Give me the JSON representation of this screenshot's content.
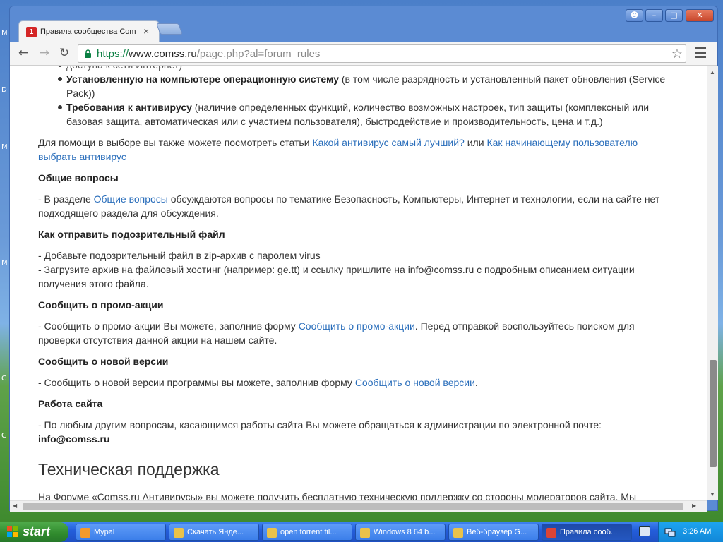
{
  "desktop": {
    "letters": [
      "M",
      "D",
      "M",
      "M",
      "C",
      "G"
    ]
  },
  "window": {
    "tab": {
      "favicon_text": "1",
      "title": "Правила сообщества Comss",
      "close_glyph": "×"
    },
    "controls": {
      "user_glyph": "☻",
      "minimize_glyph": "–",
      "maximize_glyph": "□",
      "close_glyph": "✕"
    }
  },
  "toolbar": {
    "back_glyph": "←",
    "forward_glyph": "→",
    "reload_glyph": "↻",
    "url": {
      "scheme": "https://",
      "host": "www.comss.ru",
      "path": "/page.php?al=forum_rules"
    },
    "star_glyph": "☆"
  },
  "content": {
    "cut_line": "доступа к сети Интернет)",
    "bullets": [
      {
        "bold": "Установленную на компьютере операционную систему",
        "text": " (в том числе разрядность и установленный пакет обновления (Service Pack))"
      },
      {
        "bold": "Требования к антивирусу",
        "text": " (наличие определенных функций, количество возможных настроек, тип защиты (комплексный или базовая защита, автоматическая или с участием пользователя), быстродействие и производительность, цена и т.д.)"
      }
    ],
    "help": {
      "pre": "Для помощи в выборе вы также можете посмотреть статьи ",
      "link1": "Какой антивирус самый лучший?",
      "mid": " или ",
      "link2": "Как начинающему пользователю выбрать антивирус"
    },
    "general": {
      "title": "Общие вопросы",
      "pre": "- В разделе ",
      "link": "Общие вопросы",
      "post": " обсуждаются вопросы по тематике Безопасность, Компьютеры, Интернет и технологии, если на сайте нет подходящего раздела для обсуждения."
    },
    "suspicious": {
      "title": "Как отправить подозрительный файл",
      "line1": "- Добавьте подозрительный файл в zip-архив с паролем virus",
      "line2": "- Загрузите архив на файловый хостинг (например: ge.tt) и ссылку пришлите на info@comss.ru с подробным описанием ситуации получения этого файла."
    },
    "promo": {
      "title": "Сообщить о промо-акции",
      "pre": "- Сообщить о промо-акции Вы можете, заполнив форму ",
      "link": "Сообщить о промо-акции",
      "post": ". Перед отправкой воспользуйтесь поиском для проверки отсутствия данной акции на нашем сайте."
    },
    "version": {
      "title": "Сообщить о новой версии",
      "pre": "- Сообщить о новой версии программы вы можете, заполнив форму ",
      "link": "Сообщить о новой версии",
      "post": "."
    },
    "site": {
      "title": "Работа сайта",
      "text": "- По любым другим вопросам, касающимся работы сайта Вы можете обращаться к администрации по электронной почте:",
      "email": "info@comss.ru"
    },
    "support": {
      "heading": "Техническая поддержка",
      "text": "На Форуме «Comss.ru Антивирусы» вы можете получить бесплатную техническую поддержку со стороны модераторов сайта. Мы"
    }
  },
  "taskbar": {
    "start_label": "start",
    "items": [
      {
        "label": "Mypal",
        "color": "#f39a2b",
        "active": false
      },
      {
        "label": "Скачать Янде...",
        "color": "#e9c24a",
        "active": false
      },
      {
        "label": "open torrent fil...",
        "color": "#e9c24a",
        "active": false
      },
      {
        "label": "Windows 8 64 b...",
        "color": "#e9c24a",
        "active": false
      },
      {
        "label": "Веб-браузер G...",
        "color": "#e9c24a",
        "active": false
      },
      {
        "label": "Правила сооб...",
        "color": "#db4437",
        "active": true
      }
    ],
    "clock": "3:26 AM"
  }
}
